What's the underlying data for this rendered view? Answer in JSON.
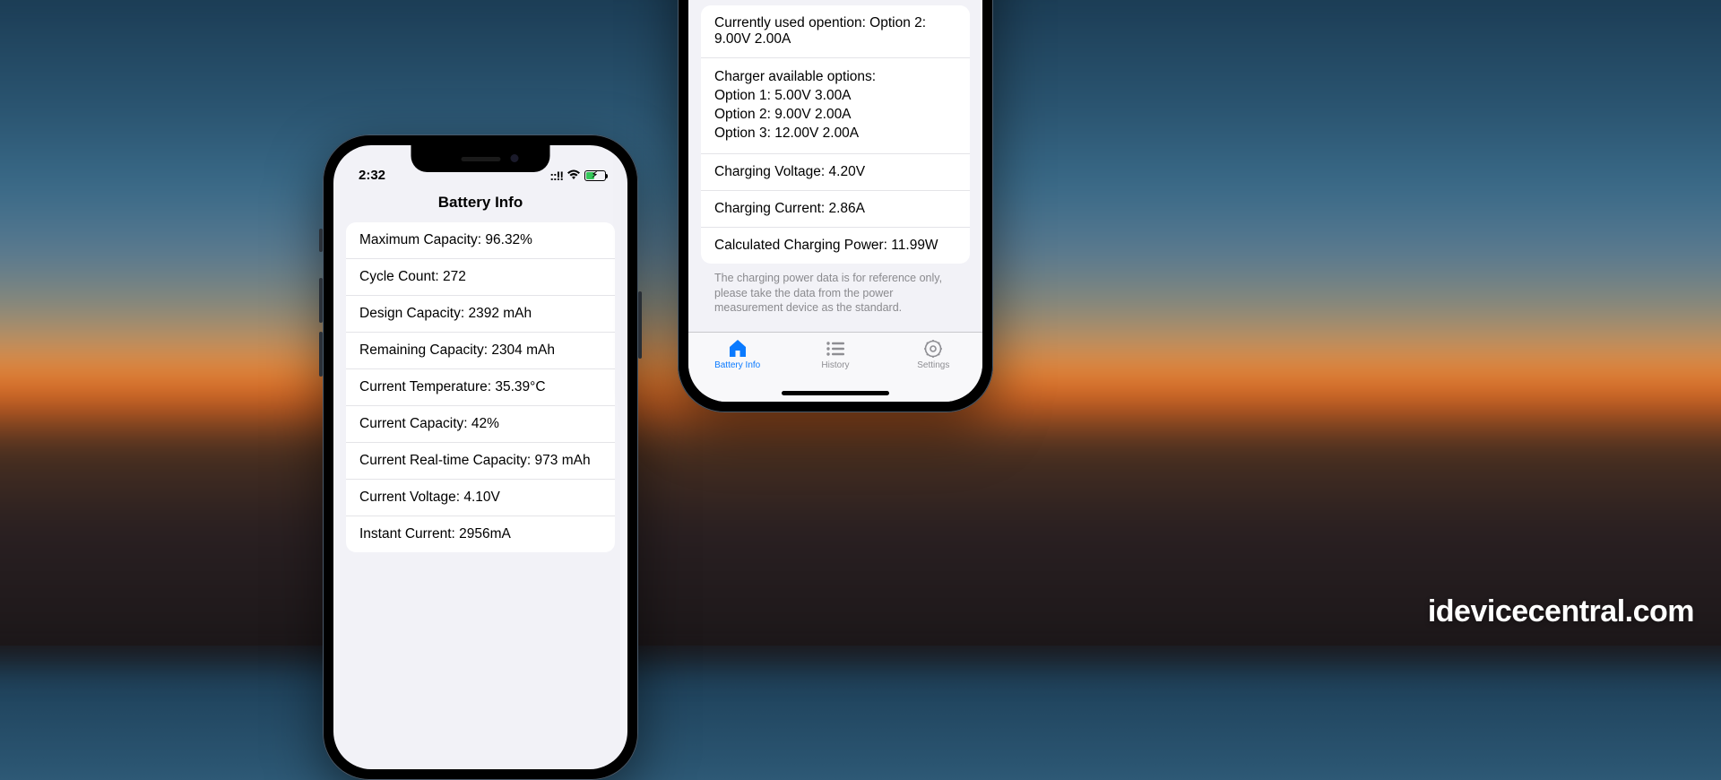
{
  "watermark": "idevicecentral.com",
  "phone1": {
    "time": "2:32",
    "signal": "::!!",
    "title": "Battery Info",
    "rows": [
      "Maximum Capacity: 96.32%",
      "Cycle Count: 272",
      "Design Capacity: 2392 mAh",
      "Remaining Capacity: 2304 mAh",
      "Current Temperature: 35.39°C",
      "Current Capacity: 42%",
      "Current Real-time Capacity: 973 mAh",
      "Current Voltage: 4.10V",
      "Instant Current: 2956mA"
    ]
  },
  "phone2": {
    "block1": [
      "Currently used opention: Option 2: 9.00V 2.00A"
    ],
    "block2_head": "Charger available options:",
    "block2_lines": [
      "Option 1: 5.00V 3.00A",
      "Option 2: 9.00V 2.00A",
      "Option 3: 12.00V 2.00A"
    ],
    "rows": [
      "Charging Voltage: 4.20V",
      "Charging Current: 2.86A",
      "Calculated Charging Power: 11.99W"
    ],
    "footnote": "The charging power data is for reference only, please take the data from the power measurement device as the standard.",
    "tabs": {
      "battery": "Battery Info",
      "history": "History",
      "settings": "Settings"
    }
  }
}
